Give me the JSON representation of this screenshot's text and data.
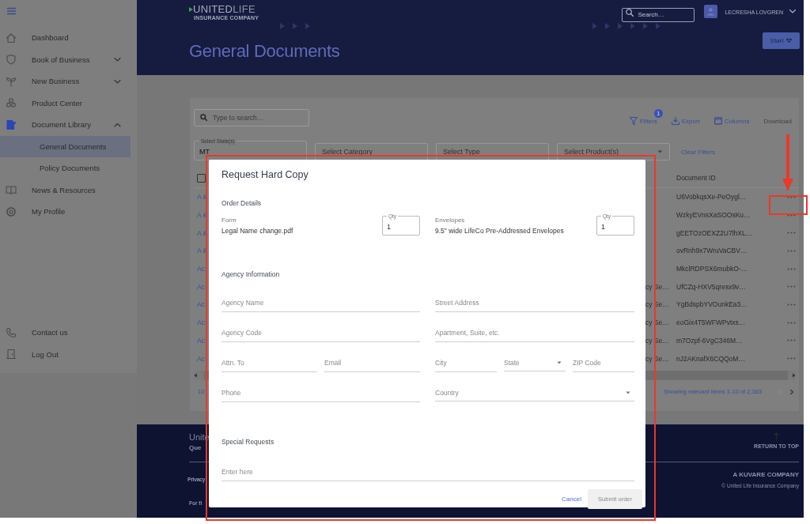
{
  "sidebar": {
    "items": [
      {
        "label": "Dashboard",
        "selected": false
      },
      {
        "label": "Book of Business",
        "selected": false,
        "expanded": false
      },
      {
        "label": "New Business",
        "selected": false,
        "expanded": false
      },
      {
        "label": "Product Center",
        "selected": false
      },
      {
        "label": "Document Library",
        "selected": true,
        "expanded": true,
        "children": [
          {
            "label": "General Documents",
            "selected": true
          },
          {
            "label": "Policy Documents",
            "selected": false
          }
        ]
      },
      {
        "label": "News & Resources",
        "selected": false
      },
      {
        "label": "My Profile",
        "selected": false
      }
    ],
    "bottom_items": [
      {
        "label": "Contact us"
      },
      {
        "label": "Log Out"
      }
    ]
  },
  "header": {
    "logo": "**UNITED**LIFE",
    "logo_tagline": "INSURANCE COMPANY",
    "search": {
      "placeholder": "Search…"
    },
    "user_name": "LECRESHA LOVGREN",
    "page_title": "General Documents",
    "start_button": "Start"
  },
  "documents": {
    "search": {
      "placeholder": "Type to search…"
    },
    "actions": [
      {
        "label": "Filters",
        "badge": "1",
        "disabled": false
      },
      {
        "label": "Export",
        "disabled": false
      },
      {
        "label": "Columns",
        "disabled": false
      },
      {
        "label": "Download",
        "disabled": true
      }
    ],
    "filters": [
      {
        "label": "Select State(s)",
        "value": "MT"
      },
      {
        "placeholder": "Select Category"
      },
      {
        "placeholder": "Select Type"
      },
      {
        "placeholder": "Select Product(s)"
      }
    ],
    "clear_filters": "Clear Filters",
    "table": {
      "select_all_checked": false,
      "columns": [
        {
          "label": "Document ID"
        }
      ],
      "rows": [
        {
          "column_1": "A &",
          "document_id": "U6VobkqsXe-PeOygl…"
        },
        {
          "column_1": "A &",
          "document_id": "WzkyEVnsXaSOOsKu…"
        },
        {
          "column_1": "A &",
          "document_id": "gEETOzOEXZ2U7lhXL…"
        },
        {
          "column_1": "A &",
          "document_id": "ovRnh9x7WruVaCBV…"
        },
        {
          "column_1": "Ac",
          "document_id": "MkclRDPSX6mubkO-…"
        },
        {
          "column_1": "Ac",
          "column_2": "cy Se…",
          "document_id": "UfCZq-HXV5qresx9v…"
        },
        {
          "column_1": "Ac",
          "column_2": "cy Se…",
          "document_id": "YgBdspbYVOunkEa3…"
        },
        {
          "column_1": "Ac",
          "column_2": "cy Se…",
          "document_id": "eoGix4T5WFWPvtxs…"
        },
        {
          "column_1": "Ac",
          "column_2": "cy Se…",
          "document_id": "m7Ozpf-6VgC346M…"
        },
        {
          "column_1": "Ac",
          "column_2": "cy Se…",
          "document_id": "nJ2AKnafX6CQQoM…"
        }
      ]
    },
    "page_size": "10",
    "summary": "Showing relevant items 1-10 of 2,363"
  },
  "footer": {
    "title": "Unite",
    "subtitle": "Que",
    "link": "Privacy",
    "note": "For fi",
    "return_to_top": "RETURN TO TOP",
    "company": "A KUVARE COMPANY",
    "copyright": "© United Life Insurance Company"
  },
  "modal": {
    "title": "Request Hard Copy",
    "order_details": {
      "heading": "Order Details",
      "items": [
        {
          "label": "Form",
          "value": "Legal Name change.pdf",
          "qty_label": "Qty",
          "qty": "1"
        },
        {
          "label": "Envelopes",
          "value": "9.5\" wide LifeCo Pre-Addressed Envelopes",
          "qty_label": "Qty",
          "qty": "1"
        }
      ]
    },
    "agency": {
      "heading": "Agency Information",
      "rows": [
        {
          "left": [
            {
              "kind": "text",
              "placeholder": "Agency Name"
            }
          ],
          "right": [
            {
              "kind": "text",
              "placeholder": "Street Address"
            }
          ]
        },
        {
          "left": [
            {
              "kind": "text",
              "placeholder": "Agency Code"
            }
          ],
          "right": [
            {
              "kind": "text",
              "placeholder": "Apartment, Suite, etc."
            }
          ]
        },
        {
          "left": [
            {
              "kind": "text",
              "placeholder": "Attn. To"
            },
            {
              "kind": "text",
              "placeholder": "Email"
            }
          ],
          "right": [
            {
              "kind": "text",
              "placeholder": "City"
            },
            {
              "kind": "select",
              "placeholder": "State"
            },
            {
              "kind": "text",
              "placeholder": "ZIP Code"
            }
          ]
        },
        {
          "left": [
            {
              "kind": "text",
              "placeholder": "Phone"
            }
          ],
          "right": [
            {
              "kind": "select",
              "placeholder": "Country"
            }
          ]
        }
      ]
    },
    "special_requests": {
      "heading": "Special Requests",
      "placeholder": "Enter here"
    },
    "buttons": [
      {
        "label": "Cancel",
        "kind": "link",
        "disabled": false
      },
      {
        "label": "Submit order",
        "kind": "primary",
        "disabled": true
      }
    ]
  },
  "annotations": [
    {
      "kind": "box"
    },
    {
      "kind": "arrow"
    },
    {
      "kind": "box"
    }
  ]
}
